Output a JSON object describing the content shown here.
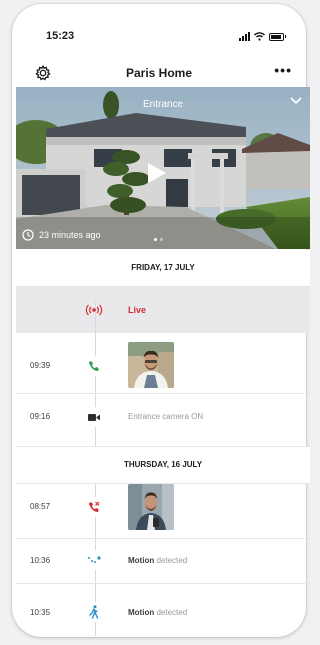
{
  "status": {
    "time": "15:23"
  },
  "header": {
    "title": "Paris Home"
  },
  "hero": {
    "camera": "Entrance",
    "ago": "23 minutes ago"
  },
  "days": [
    "FRIDAY, 17 JULY",
    "THURSDAY, 16 JULY"
  ],
  "live": {
    "label": "Live"
  },
  "events": {
    "e1": {
      "time": "09:39"
    },
    "e2": {
      "time": "09:16",
      "text": "Entrance camera ON"
    },
    "e3": {
      "time": "08:57"
    },
    "e4": {
      "time": "10:36",
      "bold": "Motion",
      "text": "detected"
    },
    "e5": {
      "time": "10:35",
      "bold": "Motion",
      "text": "detected"
    }
  },
  "colors": {
    "live_red": "#d32f2f",
    "call_green": "#2e9e4f",
    "missed_red": "#d32f2f",
    "motion_blue": "#2a8fc7"
  },
  "icons": [
    "settings-gear-icon",
    "more-dots-icon",
    "chevron-down-icon",
    "play-icon",
    "clock-icon",
    "live-broadcast-icon",
    "phone-call-icon",
    "video-camera-icon",
    "missed-call-icon",
    "motion-dots-icon",
    "walking-person-icon"
  ]
}
